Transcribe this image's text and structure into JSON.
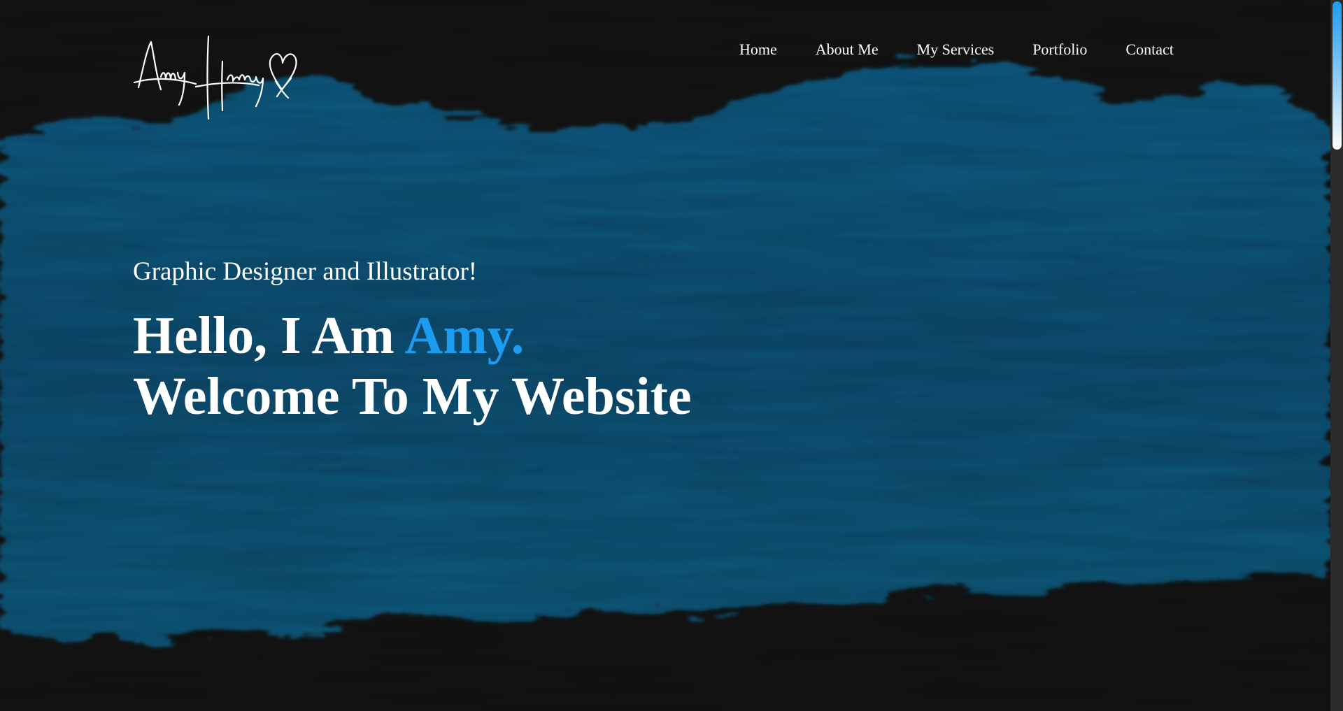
{
  "logo": {
    "name": "Amy Harvey",
    "icon": "heart-icon",
    "color": "#ffffff"
  },
  "nav": {
    "items": [
      {
        "label": "Home"
      },
      {
        "label": "About Me"
      },
      {
        "label": "My Services"
      },
      {
        "label": "Portfolio"
      },
      {
        "label": "Contact"
      }
    ]
  },
  "hero": {
    "subtitle": "Graphic Designer and Illustrator!",
    "greeting": "Hello, I Am ",
    "name": "Amy.",
    "welcome": "Welcome To My Website"
  },
  "colors": {
    "background": "#141414",
    "brush": "#0a4f72",
    "accent": "#1b9cf0",
    "text": "#ffffff"
  }
}
